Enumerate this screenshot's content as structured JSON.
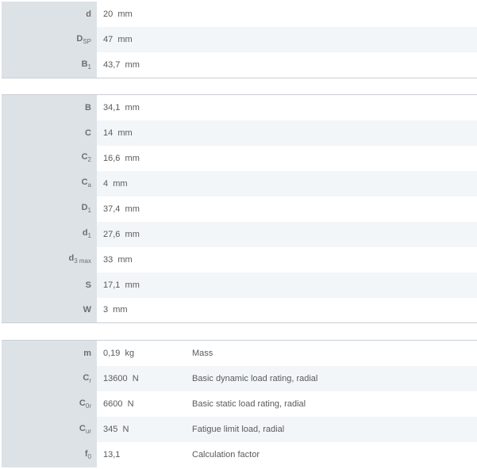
{
  "groups": [
    {
      "rows": [
        {
          "sym": "d",
          "sub": "",
          "value": "20",
          "unit": "mm"
        },
        {
          "sym": "D",
          "sub": "SP",
          "value": "47",
          "unit": "mm"
        },
        {
          "sym": "B",
          "sub": "1",
          "value": "43,7",
          "unit": "mm"
        }
      ]
    },
    {
      "rows": [
        {
          "sym": "B",
          "sub": "",
          "value": "34,1",
          "unit": "mm"
        },
        {
          "sym": "C",
          "sub": "",
          "value": "14",
          "unit": "mm"
        },
        {
          "sym": "C",
          "sub": "2",
          "value": "16,6",
          "unit": "mm"
        },
        {
          "sym": "C",
          "sub": "a",
          "value": "4",
          "unit": "mm"
        },
        {
          "sym": "D",
          "sub": "1",
          "value": "37,4",
          "unit": "mm"
        },
        {
          "sym": "d",
          "sub": "1",
          "value": "27,6",
          "unit": "mm"
        },
        {
          "sym": "d",
          "sub": "3 max",
          "value": "33",
          "unit": "mm"
        },
        {
          "sym": "S",
          "sub": "",
          "value": "17,1",
          "unit": "mm"
        },
        {
          "sym": "W",
          "sub": "",
          "value": "3",
          "unit": "mm"
        }
      ]
    },
    {
      "rows": [
        {
          "sym": "m",
          "sub": "",
          "value": "0,19",
          "unit": "kg",
          "desc": "Mass"
        },
        {
          "sym": "C",
          "sub": "r",
          "value": "13600",
          "unit": "N",
          "desc": "Basic dynamic load rating, radial"
        },
        {
          "sym": "C",
          "sub": "0r",
          "value": "6600",
          "unit": "N",
          "desc": "Basic static load rating, radial"
        },
        {
          "sym": "C",
          "sub": "ur",
          "value": "345",
          "unit": "N",
          "desc": "Fatigue limit load, radial"
        },
        {
          "sym": "f",
          "sub": "0",
          "value": "13,1",
          "unit": "",
          "desc": "Calculation factor"
        }
      ]
    }
  ]
}
